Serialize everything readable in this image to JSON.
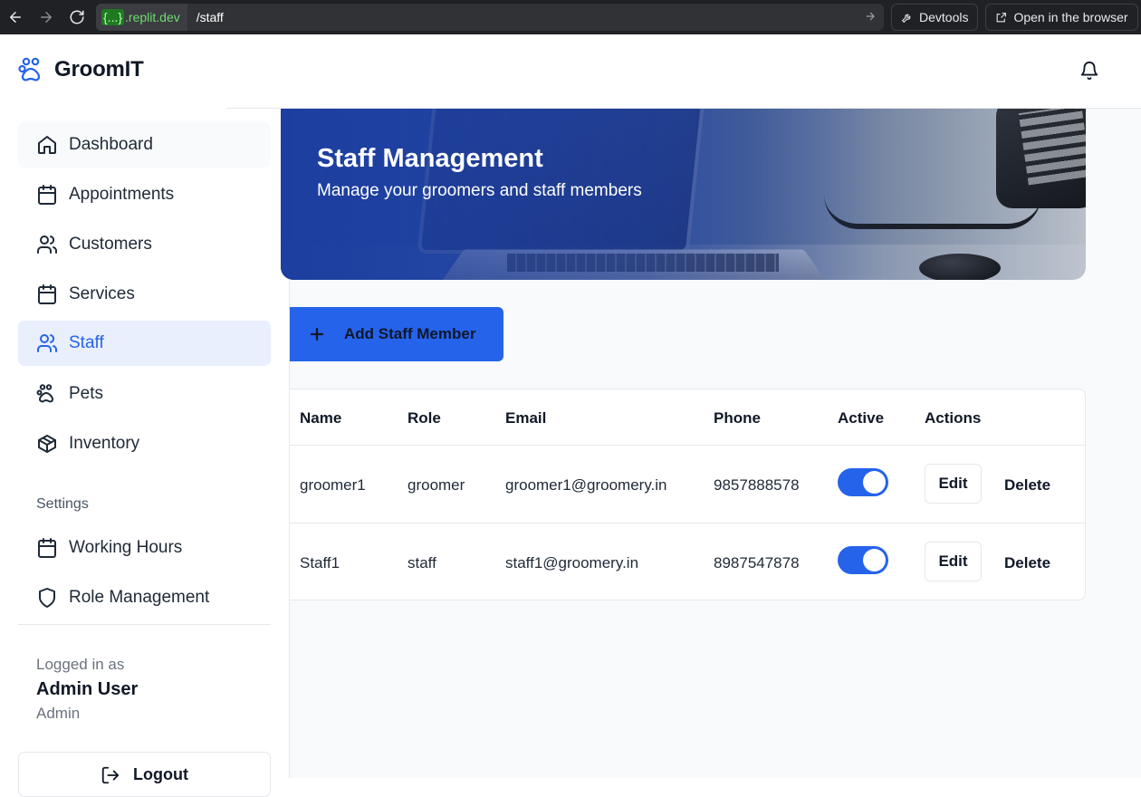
{
  "browser": {
    "host_brace": "{...}",
    "host": ".replit.dev",
    "path": "/staff",
    "devtools_label": "Devtools",
    "open_browser_label": "Open in the browser"
  },
  "app": {
    "name": "GroomIT"
  },
  "sidebar": {
    "items": [
      {
        "label": "Dashboard",
        "icon": "home-icon"
      },
      {
        "label": "Appointments",
        "icon": "calendar-icon"
      },
      {
        "label": "Customers",
        "icon": "users-icon"
      },
      {
        "label": "Services",
        "icon": "calendar-icon"
      },
      {
        "label": "Staff",
        "icon": "users-icon",
        "active": true
      },
      {
        "label": "Pets",
        "icon": "paw-icon"
      },
      {
        "label": "Inventory",
        "icon": "box-icon"
      }
    ],
    "settings_label": "Settings",
    "settings_items": [
      {
        "label": "Working Hours",
        "icon": "calendar-icon"
      },
      {
        "label": "Role Management",
        "icon": "shield-icon"
      }
    ],
    "user": {
      "logged_in_label": "Logged in as",
      "name": "Admin User",
      "role": "Admin"
    },
    "logout_label": "Logout"
  },
  "hero": {
    "title": "Staff Management",
    "subtitle": "Manage your groomers and staff members"
  },
  "add_button_label": "Add Staff Member",
  "table": {
    "headers": [
      "Name",
      "Role",
      "Email",
      "Phone",
      "Active",
      "Actions"
    ],
    "rows": [
      {
        "name": "groomer1",
        "role": "groomer",
        "email": "groomer1@groomery.in",
        "phone": "9857888578",
        "active": true,
        "edit": "Edit",
        "delete": "Delete"
      },
      {
        "name": "Staff1",
        "role": "staff",
        "email": "staff1@groomery.in",
        "phone": "8987547878",
        "active": true,
        "edit": "Edit",
        "delete": "Delete"
      }
    ]
  },
  "colors": {
    "accent": "#2563eb",
    "active_nav_bg": "#e9effc"
  }
}
